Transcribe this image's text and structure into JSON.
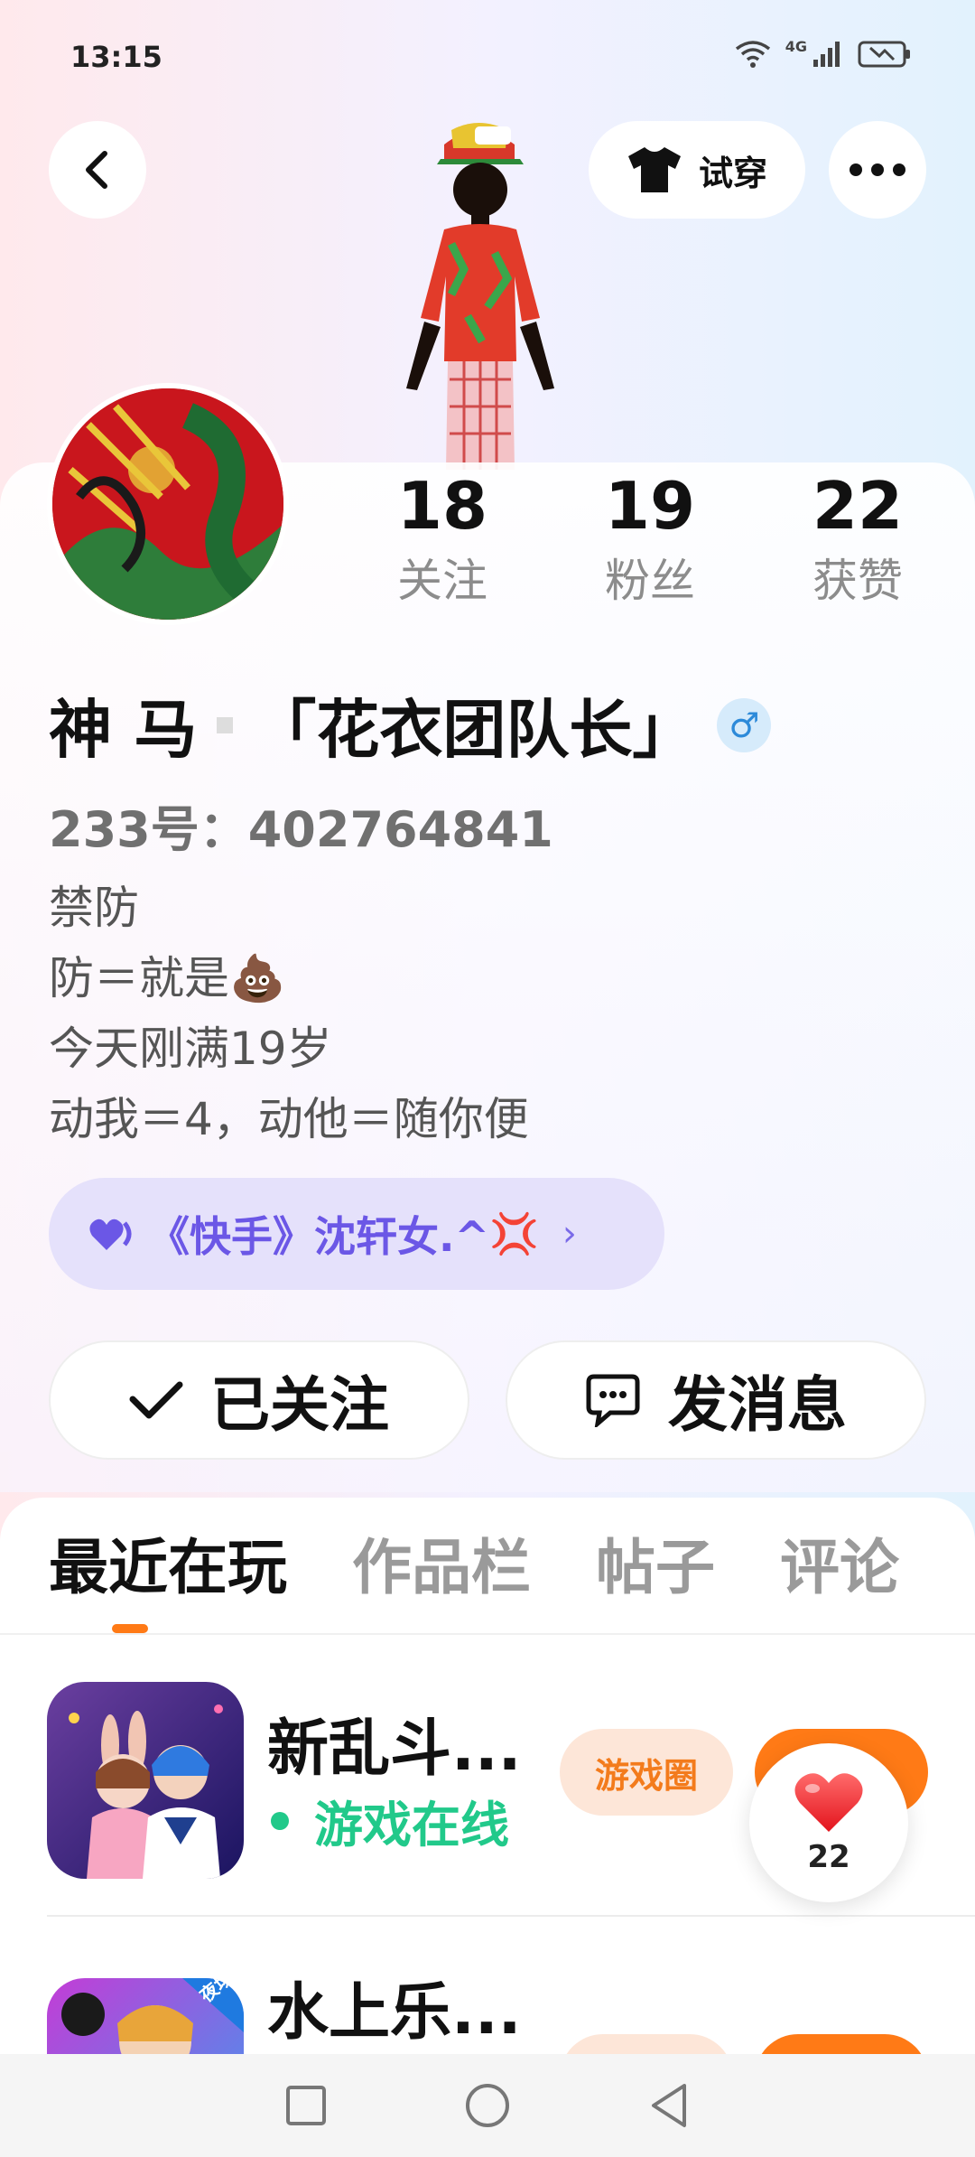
{
  "status_bar": {
    "time": "13:15",
    "network": "4G"
  },
  "header": {
    "tryon_label": "试穿"
  },
  "stats": [
    {
      "value": "18",
      "label": "关注"
    },
    {
      "value": "19",
      "label": "粉丝"
    },
    {
      "value": "22",
      "label": "获赞"
    }
  ],
  "profile": {
    "name_prefix": "神 马",
    "name_suffix": "「花衣团队长」",
    "gender_symbol": "♂",
    "id_text": "233号：402764841",
    "bio": [
      "禁防",
      "防＝就是",
      "今天刚满19岁",
      "动我＝4，动他＝随你便"
    ],
    "bio_emoji": "💩"
  },
  "link": {
    "text": "《快手》沈轩女.^",
    "emoji": "💢",
    "chevron": "›"
  },
  "actions": {
    "follow_label": "已关注",
    "message_label": "发消息"
  },
  "tabs": [
    "最近在玩",
    "作品栏",
    "帖子",
    "评论"
  ],
  "games": [
    {
      "title": "新乱斗...",
      "status": "游戏在线",
      "circle_label": "游戏圈"
    },
    {
      "title": "水上乐...",
      "badge": "夜场版"
    }
  ],
  "like_button": {
    "count": "22"
  },
  "colors": {
    "accent": "#ff7a16",
    "online": "#21c98a",
    "link": "#6b57e6"
  }
}
